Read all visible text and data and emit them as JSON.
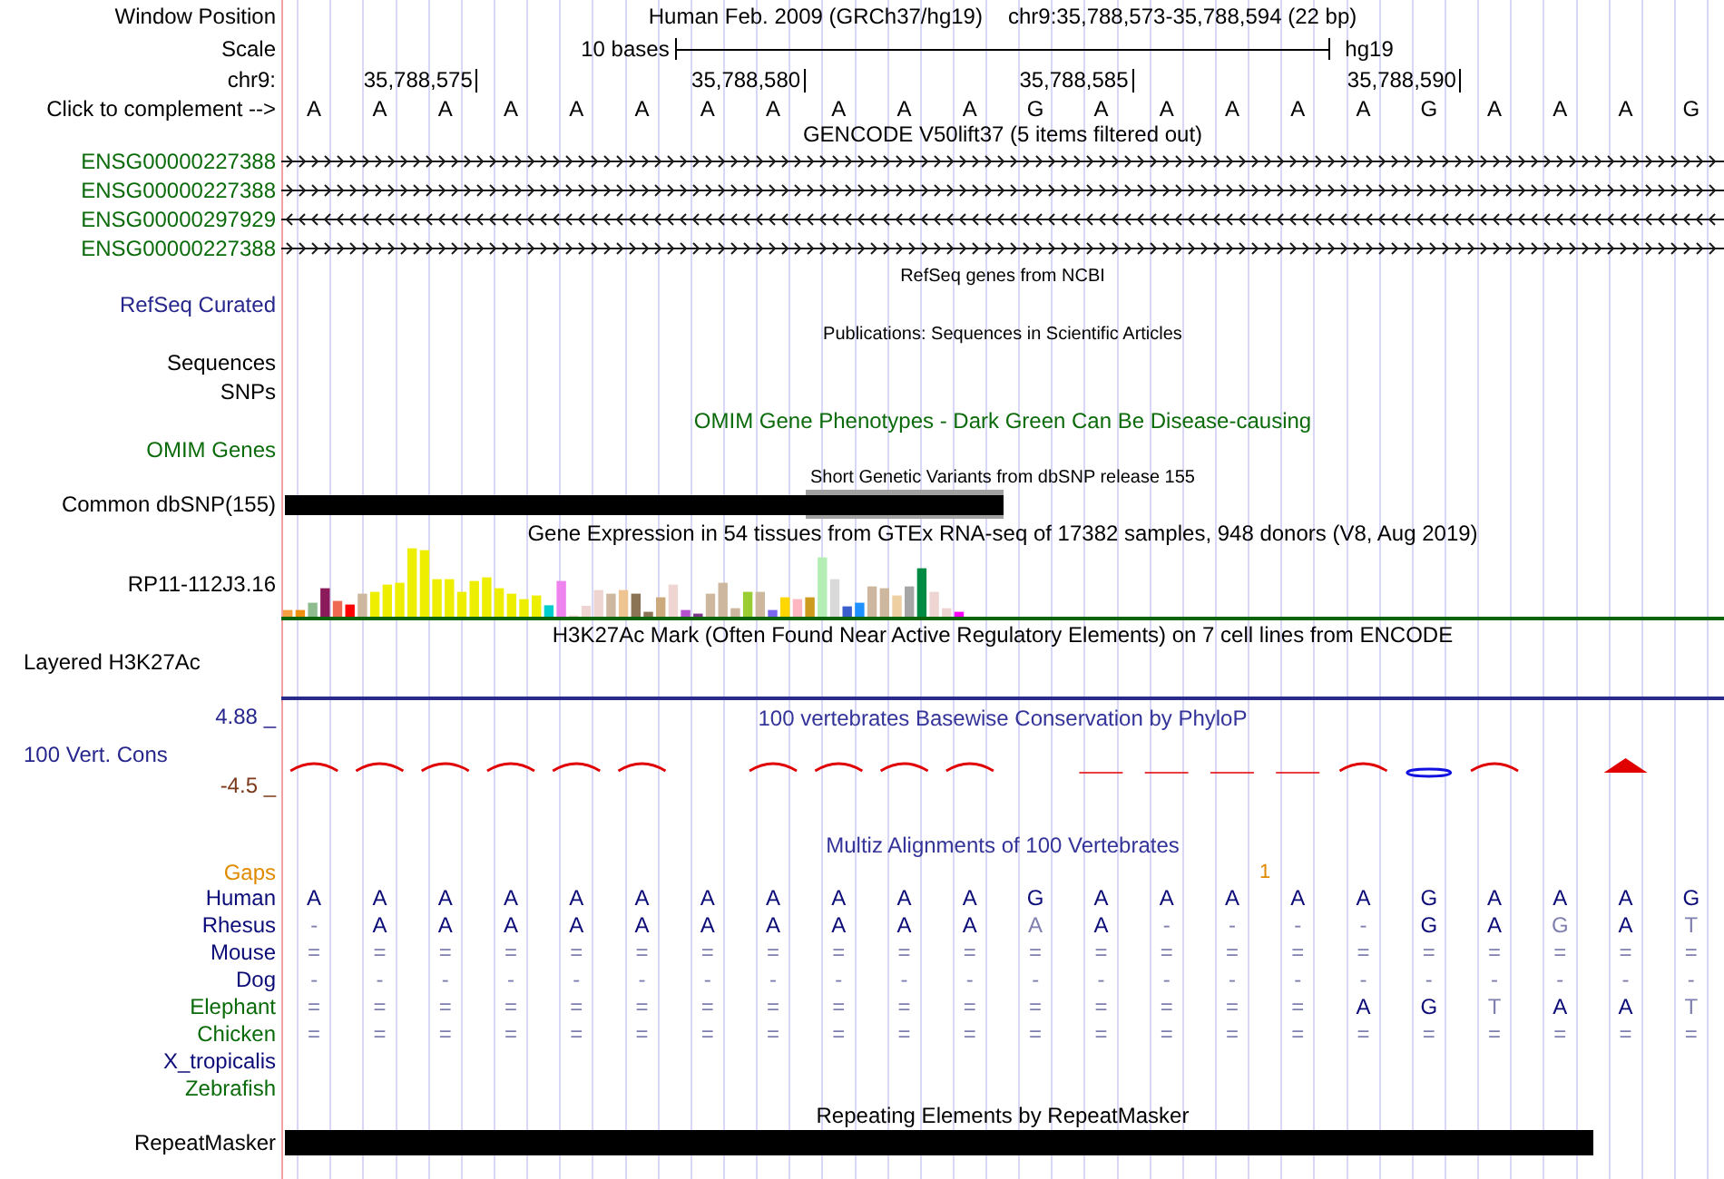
{
  "window_position": {
    "label": "Window Position",
    "assembly": "Human Feb. 2009 (GRCh37/hg19)",
    "range": "chr9:35,788,573-35,788,594 (22 bp)"
  },
  "scale": {
    "label": "Scale",
    "length": "10 bases",
    "assembly": "hg19"
  },
  "ruler": {
    "label": "chr9:",
    "ticks": [
      "35,788,575",
      "35,788,580",
      "35,788,585",
      "35,788,590"
    ]
  },
  "sequence": {
    "label": "Click to complement -->",
    "bases": [
      "A",
      "A",
      "A",
      "A",
      "A",
      "A",
      "A",
      "A",
      "A",
      "A",
      "A",
      "G",
      "A",
      "A",
      "A",
      "A",
      "A",
      "G",
      "A",
      "A",
      "A",
      "G"
    ]
  },
  "gencode": {
    "title": "GENCODE V50lift37 (5 items filtered out)",
    "genes": [
      {
        "name": "ENSG00000227388",
        "reverse": false
      },
      {
        "name": "ENSG00000227388",
        "reverse": false
      },
      {
        "name": "ENSG00000297929",
        "reverse": true
      },
      {
        "name": "ENSG00000227388",
        "reverse": false
      }
    ]
  },
  "refseq": {
    "title": "RefSeq genes from NCBI",
    "label": "RefSeq Curated"
  },
  "publications": {
    "title": "Publications: Sequences in Scientific Articles",
    "labels": [
      "Sequences",
      "SNPs"
    ]
  },
  "omim": {
    "title": "OMIM Gene Phenotypes - Dark Green Can Be Disease-causing",
    "label": "OMIM Genes"
  },
  "dbsnp": {
    "title": "Short Genetic Variants from dbSNP release 155",
    "label": "Common dbSNP(155)"
  },
  "gtex": {
    "title": "Gene Expression in 54 tissues from GTEx RNA-seq of 17382 samples, 948 donors (V8, Aug 2019)",
    "gene": "RP11-112J3.16"
  },
  "h3k27ac": {
    "title": "H3K27Ac Mark (Often Found Near Active Regulatory Elements) on 7 cell lines from ENCODE",
    "label": "Layered H3K27Ac"
  },
  "conservation": {
    "title": "100 vertebrates Basewise Conservation by PhyloP",
    "label": "100 Vert. Cons",
    "max": "4.88 _",
    "min": "-4.5 _"
  },
  "multiz": {
    "title": "Multiz Alignments of 100 Vertebrates",
    "gaps": {
      "label": "Gaps",
      "count": "1"
    },
    "species": [
      {
        "name": "Human",
        "color": "#0c0c78",
        "bases": [
          "A",
          "A",
          "A",
          "A",
          "A",
          "A",
          "A",
          "A",
          "A",
          "A",
          "A",
          "G",
          "A",
          "A",
          "A",
          "A",
          "A",
          "G",
          "A",
          "A",
          "A",
          "G"
        ]
      },
      {
        "name": "Rhesus",
        "color": "#0c0c78",
        "bases": [
          "-",
          "A",
          "A",
          "A",
          "A",
          "A",
          "A",
          "A",
          "A",
          "A",
          "A",
          "A",
          "A",
          "-",
          "-",
          "-",
          "-",
          "G",
          "A",
          "G",
          "A",
          "T"
        ],
        "dim": [
          true,
          false,
          false,
          false,
          false,
          false,
          false,
          false,
          false,
          false,
          false,
          true,
          false,
          true,
          true,
          true,
          true,
          false,
          false,
          true,
          false,
          true
        ]
      },
      {
        "name": "Mouse",
        "color": "#0c0c78",
        "bases": [
          "=",
          "=",
          "=",
          "=",
          "=",
          "=",
          "=",
          "=",
          "=",
          "=",
          "=",
          "=",
          "=",
          "=",
          "=",
          "=",
          "=",
          "=",
          "=",
          "=",
          "=",
          "="
        ],
        "dim": [
          true,
          true,
          true,
          true,
          true,
          true,
          true,
          true,
          true,
          true,
          true,
          true,
          true,
          true,
          true,
          true,
          true,
          true,
          true,
          true,
          true,
          true
        ]
      },
      {
        "name": "Dog",
        "color": "#0c0c78",
        "bases": [
          "-",
          "-",
          "-",
          "-",
          "-",
          "-",
          "-",
          "-",
          "-",
          "-",
          "-",
          "-",
          "-",
          "-",
          "-",
          "-",
          "-",
          "-",
          "-",
          "-",
          "-",
          "-"
        ],
        "dim": [
          true,
          true,
          true,
          true,
          true,
          true,
          true,
          true,
          true,
          true,
          true,
          true,
          true,
          true,
          true,
          true,
          true,
          true,
          true,
          true,
          true,
          true
        ]
      },
      {
        "name": "Elephant",
        "color": "#0b6b0b",
        "bases": [
          "=",
          "=",
          "=",
          "=",
          "=",
          "=",
          "=",
          "=",
          "=",
          "=",
          "=",
          "=",
          "=",
          "=",
          "=",
          "=",
          "A",
          "G",
          "T",
          "A",
          "A",
          "T"
        ],
        "dim": [
          true,
          true,
          true,
          true,
          true,
          true,
          true,
          true,
          true,
          true,
          true,
          true,
          true,
          true,
          true,
          true,
          false,
          false,
          true,
          false,
          false,
          true
        ]
      },
      {
        "name": "Chicken",
        "color": "#0b6b0b",
        "bases": [
          "=",
          "=",
          "=",
          "=",
          "=",
          "=",
          "=",
          "=",
          "=",
          "=",
          "=",
          "=",
          "=",
          "=",
          "=",
          "=",
          "=",
          "=",
          "=",
          "=",
          "=",
          "="
        ],
        "dim": [
          true,
          true,
          true,
          true,
          true,
          true,
          true,
          true,
          true,
          true,
          true,
          true,
          true,
          true,
          true,
          true,
          true,
          true,
          true,
          true,
          true,
          true
        ]
      },
      {
        "name": "X_tropicalis",
        "color": "#0c0c78"
      },
      {
        "name": "Zebrafish",
        "color": "#0b6b0b"
      }
    ]
  },
  "repeatmasker": {
    "title": "Repeating Elements by RepeatMasker",
    "label": "RepeatMasker"
  }
}
